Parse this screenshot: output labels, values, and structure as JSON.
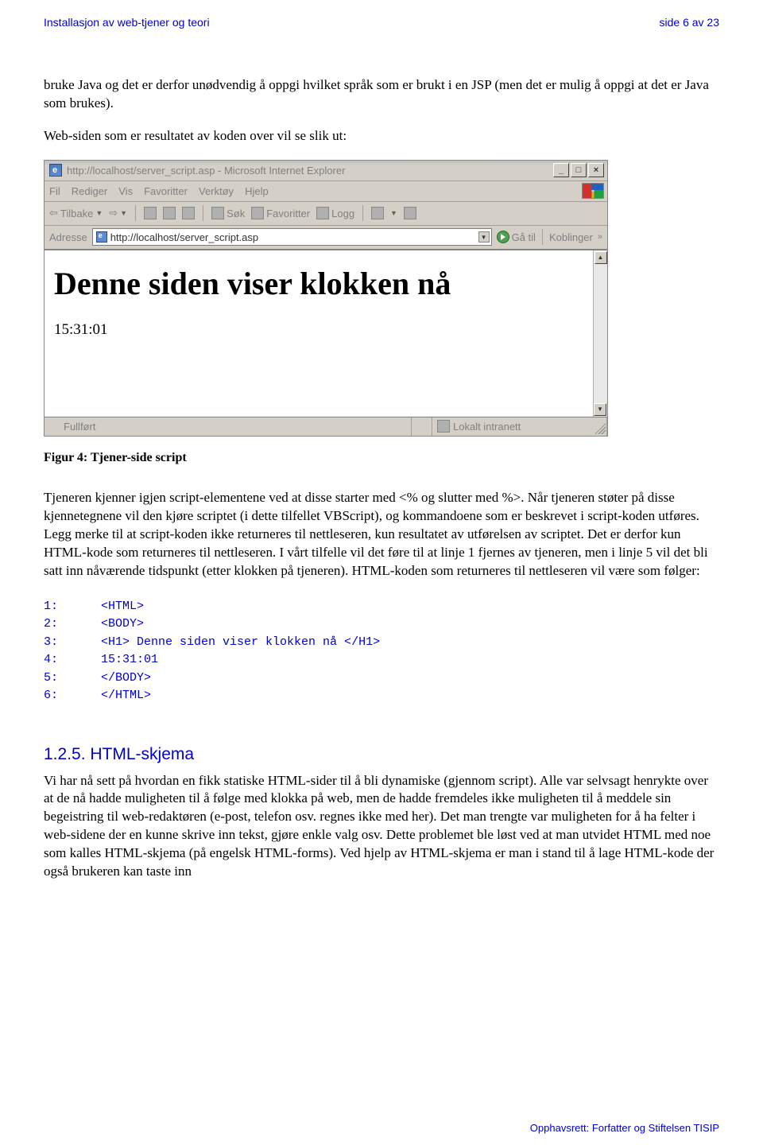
{
  "header": {
    "left": "Installasjon av web-tjener og teori",
    "right": "side 6 av 23"
  },
  "intro_para": "bruke Java og det er derfor unødvendig å oppgi hvilket språk som er brukt i en JSP (men det er mulig å oppgi at det er Java som brukes).",
  "lead_in": "Web-siden som er resultatet av koden over vil se slik ut:",
  "browser": {
    "title": "http://localhost/server_script.asp - Microsoft Internet Explorer",
    "window_buttons": {
      "min": "_",
      "max": "□",
      "close": "×"
    },
    "menu": [
      "Fil",
      "Rediger",
      "Vis",
      "Favoritter",
      "Verktøy",
      "Hjelp"
    ],
    "toolbar": {
      "back": "Tilbake",
      "search": "Søk",
      "favorites": "Favoritter",
      "history": "Logg"
    },
    "address_label": "Adresse",
    "address_url": "http://localhost/server_script.asp",
    "go_label": "Gå til",
    "links_label": "Koblinger",
    "page_h1": "Denne siden viser klokken nå",
    "page_time": "15:31:01",
    "status_left": "Fullført",
    "status_right": "Lokalt intranett"
  },
  "figure_caption": "Figur 4: Tjener-side script",
  "main_paragraph": "Tjeneren kjenner igjen script-elementene ved at disse starter med <% og slutter med %>. Når tjeneren støter på disse kjennetegnene vil den kjøre scriptet (i dette tilfellet VBScript), og kommandoene som er beskrevet i script-koden utføres. Legg merke til at script-koden ikke returneres til nettleseren, kun resultatet av utførelsen av scriptet. Det er derfor kun HTML-kode som returneres til nettleseren. I vårt tilfelle vil det føre til at linje 1 fjernes av tjeneren, men i linje 5 vil det bli satt inn nåværende tidspunkt (etter klokken på tjeneren). HTML-koden som returneres til nettleseren vil være som følger:",
  "code_lines": {
    "l1": "1:      <HTML>",
    "l2": "2:      <BODY>",
    "l3": "3:      <H1> Denne siden viser klokken nå </H1>",
    "l4": "4:      15:31:01",
    "l5": "5:      </BODY>",
    "l6": "6:      </HTML>"
  },
  "section": {
    "heading": "1.2.5. HTML-skjema",
    "paragraph": "Vi har nå sett på hvordan en fikk statiske HTML-sider til å bli dynamiske (gjennom script). Alle var selvsagt henrykte over at de nå hadde muligheten til å følge med klokka på web, men de hadde fremdeles ikke muligheten til å meddele sin begeistring til web-redaktøren (e-post, telefon osv. regnes ikke med her). Det man trengte var muligheten for å ha felter i web-sidene der en kunne skrive inn tekst, gjøre enkle valg osv. Dette problemet ble løst ved at man utvidet HTML med noe som kalles HTML-skjema (på engelsk HTML-forms). Ved hjelp av HTML-skjema er man i stand til å lage HTML-kode der også brukeren kan taste inn"
  },
  "footer": "Opphavsrett:  Forfatter og Stiftelsen TISIP"
}
